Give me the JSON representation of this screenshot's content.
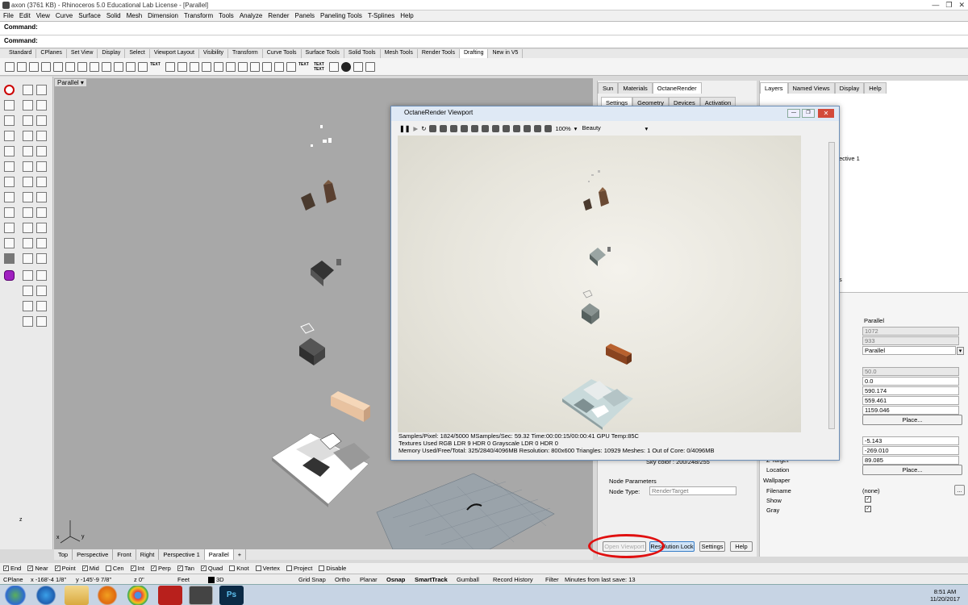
{
  "window": {
    "title": "axon (3761 KB) - Rhinoceros 5.0 Educational Lab License - [Parallel]",
    "controls": [
      "—",
      "❐",
      "✕"
    ]
  },
  "menu": [
    "File",
    "Edit",
    "View",
    "Curve",
    "Surface",
    "Solid",
    "Mesh",
    "Dimension",
    "Transform",
    "Tools",
    "Analyze",
    "Render",
    "Panels",
    "Paneling Tools",
    "T-Splines",
    "Help"
  ],
  "command": {
    "line1": "Command:",
    "line2": "Command:"
  },
  "toolbar_tabs": [
    "Standard",
    "CPlanes",
    "Set View",
    "Display",
    "Select",
    "Viewport Layout",
    "Visibility",
    "Transform",
    "Curve Tools",
    "Surface Tools",
    "Solid Tools",
    "Mesh Tools",
    "Render Tools",
    "Drafting",
    "New in V5"
  ],
  "toolbar_active_tab": "Drafting",
  "toolbar_text_icons": [
    "TEXT",
    "TEXT",
    "TEXT TEXT"
  ],
  "viewport": {
    "label": "Parallel",
    "label_arrow": "▾",
    "axis_z": "z",
    "axis_x": "x",
    "axis_y": "y",
    "tabs": [
      "Top",
      "Perspective",
      "Front",
      "Right",
      "Perspective 1",
      "Parallel"
    ],
    "active_tab": "Parallel",
    "add_tab": "+"
  },
  "osnap": [
    {
      "label": "End",
      "checked": true
    },
    {
      "label": "Near",
      "checked": true
    },
    {
      "label": "Point",
      "checked": true
    },
    {
      "label": "Mid",
      "checked": true
    },
    {
      "label": "Cen",
      "checked": false
    },
    {
      "label": "Int",
      "checked": true
    },
    {
      "label": "Perp",
      "checked": true
    },
    {
      "label": "Tan",
      "checked": true
    },
    {
      "label": "Quad",
      "checked": true
    },
    {
      "label": "Knot",
      "checked": false
    },
    {
      "label": "Vertex",
      "checked": false
    },
    {
      "label": "Project",
      "checked": false
    },
    {
      "label": "Disable",
      "checked": false
    }
  ],
  "status": {
    "cplane": "CPlane",
    "x": "x -168'-4 1/8\"",
    "y": "y -145'-9 7/8\"",
    "z": "z 0\"",
    "units": "Feet",
    "layer": "3D",
    "grid_snap": "Grid Snap",
    "ortho": "Ortho",
    "planar": "Planar",
    "osnap": "Osnap",
    "smarttrack": "SmartTrack",
    "gumball": "Gumball",
    "record_history": "Record History",
    "filter": "Filter",
    "last_save": "Minutes from last save: 13"
  },
  "octane_panel": {
    "tabs": [
      "Sun",
      "Materials",
      "OctaneRender"
    ],
    "subtabs": [
      "Settings",
      "Geometry",
      "Devices",
      "Activation"
    ],
    "sky_color": "Sky color : 200/248/255",
    "node_params_title": "Node Parameters",
    "node_type_label": "Node Type:",
    "node_type_value": "RenderTarget",
    "buttons": {
      "open_viewport": "Open Viewport",
      "resolution_lock": "Resolution Lock",
      "settings": "Settings",
      "help": "Help"
    }
  },
  "layers_panel": {
    "tabs": [
      "Layers",
      "Named Views",
      "Display",
      "Help"
    ],
    "fragment_text": "ective 1",
    "fragment_s": "s",
    "props": [
      {
        "label": "",
        "value": "Parallel"
      },
      {
        "label": "",
        "value": "1072"
      },
      {
        "label": "",
        "value": "933"
      },
      {
        "label": "",
        "value": "Parallel"
      },
      {
        "label": "",
        "value": "50.0"
      },
      {
        "label": "",
        "value": "0.0"
      },
      {
        "label": "",
        "value": "590.174"
      },
      {
        "label": "",
        "value": "559.461"
      },
      {
        "label": "",
        "value": "1159.046"
      },
      {
        "label": "",
        "value": "Place..."
      },
      {
        "label": "",
        "value": "-5.143"
      },
      {
        "label": "",
        "value": "-269.010"
      },
      {
        "label": "Z Target",
        "value": "89.085"
      },
      {
        "label": "Location",
        "value": "Place..."
      }
    ],
    "wallpaper_title": "Wallpaper",
    "filename_label": "Filename",
    "filename_value": "(none)",
    "filename_btn": "...",
    "show_label": "Show",
    "gray_label": "Gray",
    "dropdown_arrow": "▾"
  },
  "octane_window": {
    "title": "OctaneRender Viewport",
    "zoom": "100%",
    "mode": "Beauty",
    "stats": [
      "Samples/Pixel: 1824/5000  MSamples/Sec: 59.32  Time:00:00:15/00:00:41  GPU Temp:85C",
      "Textures Used RGB LDR 9  HDR 0  Grayscale LDR 0  HDR 0",
      "Memory Used/Free/Total: 325/2840/4096MB  Resolution: 800x600  Triangles: 10929  Meshes: 1 Out of Core: 0/4096MB"
    ]
  },
  "taskbar": {
    "time": "8:51 AM",
    "date": "11/20/2017",
    "app_labels": [
      "Ps"
    ]
  },
  "colors": {
    "viewport_bg": "#a8a8a8",
    "accent_red": "#e01010",
    "taskbar": "#c7d4e4"
  }
}
